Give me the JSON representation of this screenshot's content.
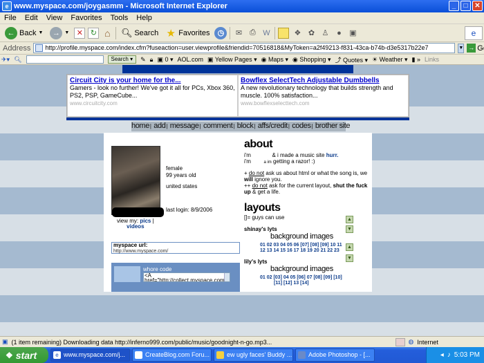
{
  "window": {
    "title": "www.myspace.com/joygasmm - Microsoft Internet Explorer"
  },
  "menu": [
    "File",
    "Edit",
    "View",
    "Favorites",
    "Tools",
    "Help"
  ],
  "toolbar": {
    "back": "Back",
    "search": "Search",
    "favorites": "Favorites"
  },
  "address": {
    "label": "Address",
    "url": "http://profile.myspace.com/index.cfm?fuseaction=user.viewprofile&friendid=70516818&MyToken=a2f49213-f831-43ca-b74b-d3e5317b22e7",
    "go": "Go"
  },
  "linksbar": {
    "search": "Search",
    "count": "0",
    "aol": "AOL.com",
    "yellow": "Yellow Pages",
    "maps": "Maps",
    "shopping": "Shopping",
    "quotes": "Quotes",
    "weather": "Weather",
    "links": "Links"
  },
  "ads": [
    {
      "title": "Circuit City is your home for the...",
      "body": "Gamers - look no further! We've got it all for PCs, Xbox 360, PS2, PSP, GameCube...",
      "url": "www.circuitcity.com"
    },
    {
      "title": "Bowflex SelectTech Adjustable Dumbbells",
      "body": "A new revolutionary technology that builds strength and muscle. 100% satisfaction...",
      "url": "www.bowflexselecttech.com"
    }
  ],
  "nav": [
    "home",
    "add",
    "message",
    "comment",
    "block",
    "affs/credit",
    "codes",
    "brother site"
  ],
  "profile": {
    "gender": "female",
    "age": "99 years old",
    "country": "united states",
    "last_login": "last login: 8/9/2006",
    "view_my": "view my:",
    "pics": "pics",
    "videos": "videos",
    "myspace_url_label": "myspace url:",
    "myspace_url": "http://www.myspace.com/",
    "whore_code": "whore code",
    "whore_code_value": "<A href=\"http://collect.myspace.com/i"
  },
  "about": {
    "header": "about",
    "line1_pre": "i'm",
    "line1_post": "& i made a music site",
    "hurr": "hurr.",
    "line2_pre": "i'm",
    "line2_small": "a im",
    "line2_post": "getting a razor! :)",
    "rule1_pre": "+",
    "rule1_u": "do not",
    "rule1_post": "ask us about html or what the song is, we",
    "rule1_will": "will",
    "rule1_end": "ignore you.",
    "rule2_pre": "++",
    "rule2_u": "do not",
    "rule2_post": "ask for the current layout,",
    "rule2_bold": "shut the fuck up",
    "rule2_end": "& get a life."
  },
  "layouts": {
    "header": "layouts",
    "note": "[]= guys can use",
    "shinay": "shinay's lyts",
    "lily": "lily's lyts",
    "bg": "background images",
    "shinay_nums1": "01 02 03 04 05 06 [07] [08] [09] 10 11",
    "shinay_nums2": "12 13 14 15 16 17 18 19 20 21 22 23",
    "lily_nums1": "01 02 [03] 04 05 [06] 07 [08] [09] [10]",
    "lily_nums2": "[11] [12] 13 [14]"
  },
  "status": {
    "text": "(1 item remaining) Downloading data http://inferno999.com/public/music/goodnight-n-go.mp3...",
    "zone": "Internet"
  },
  "taskbar": {
    "start": "start",
    "tasks": [
      "www.myspace.com/j...",
      "CreateBlog.com Foru...",
      "ew ugly faces' Buddy ...",
      "Adobe Photoshop - [..."
    ],
    "time": "5:03 PM"
  }
}
